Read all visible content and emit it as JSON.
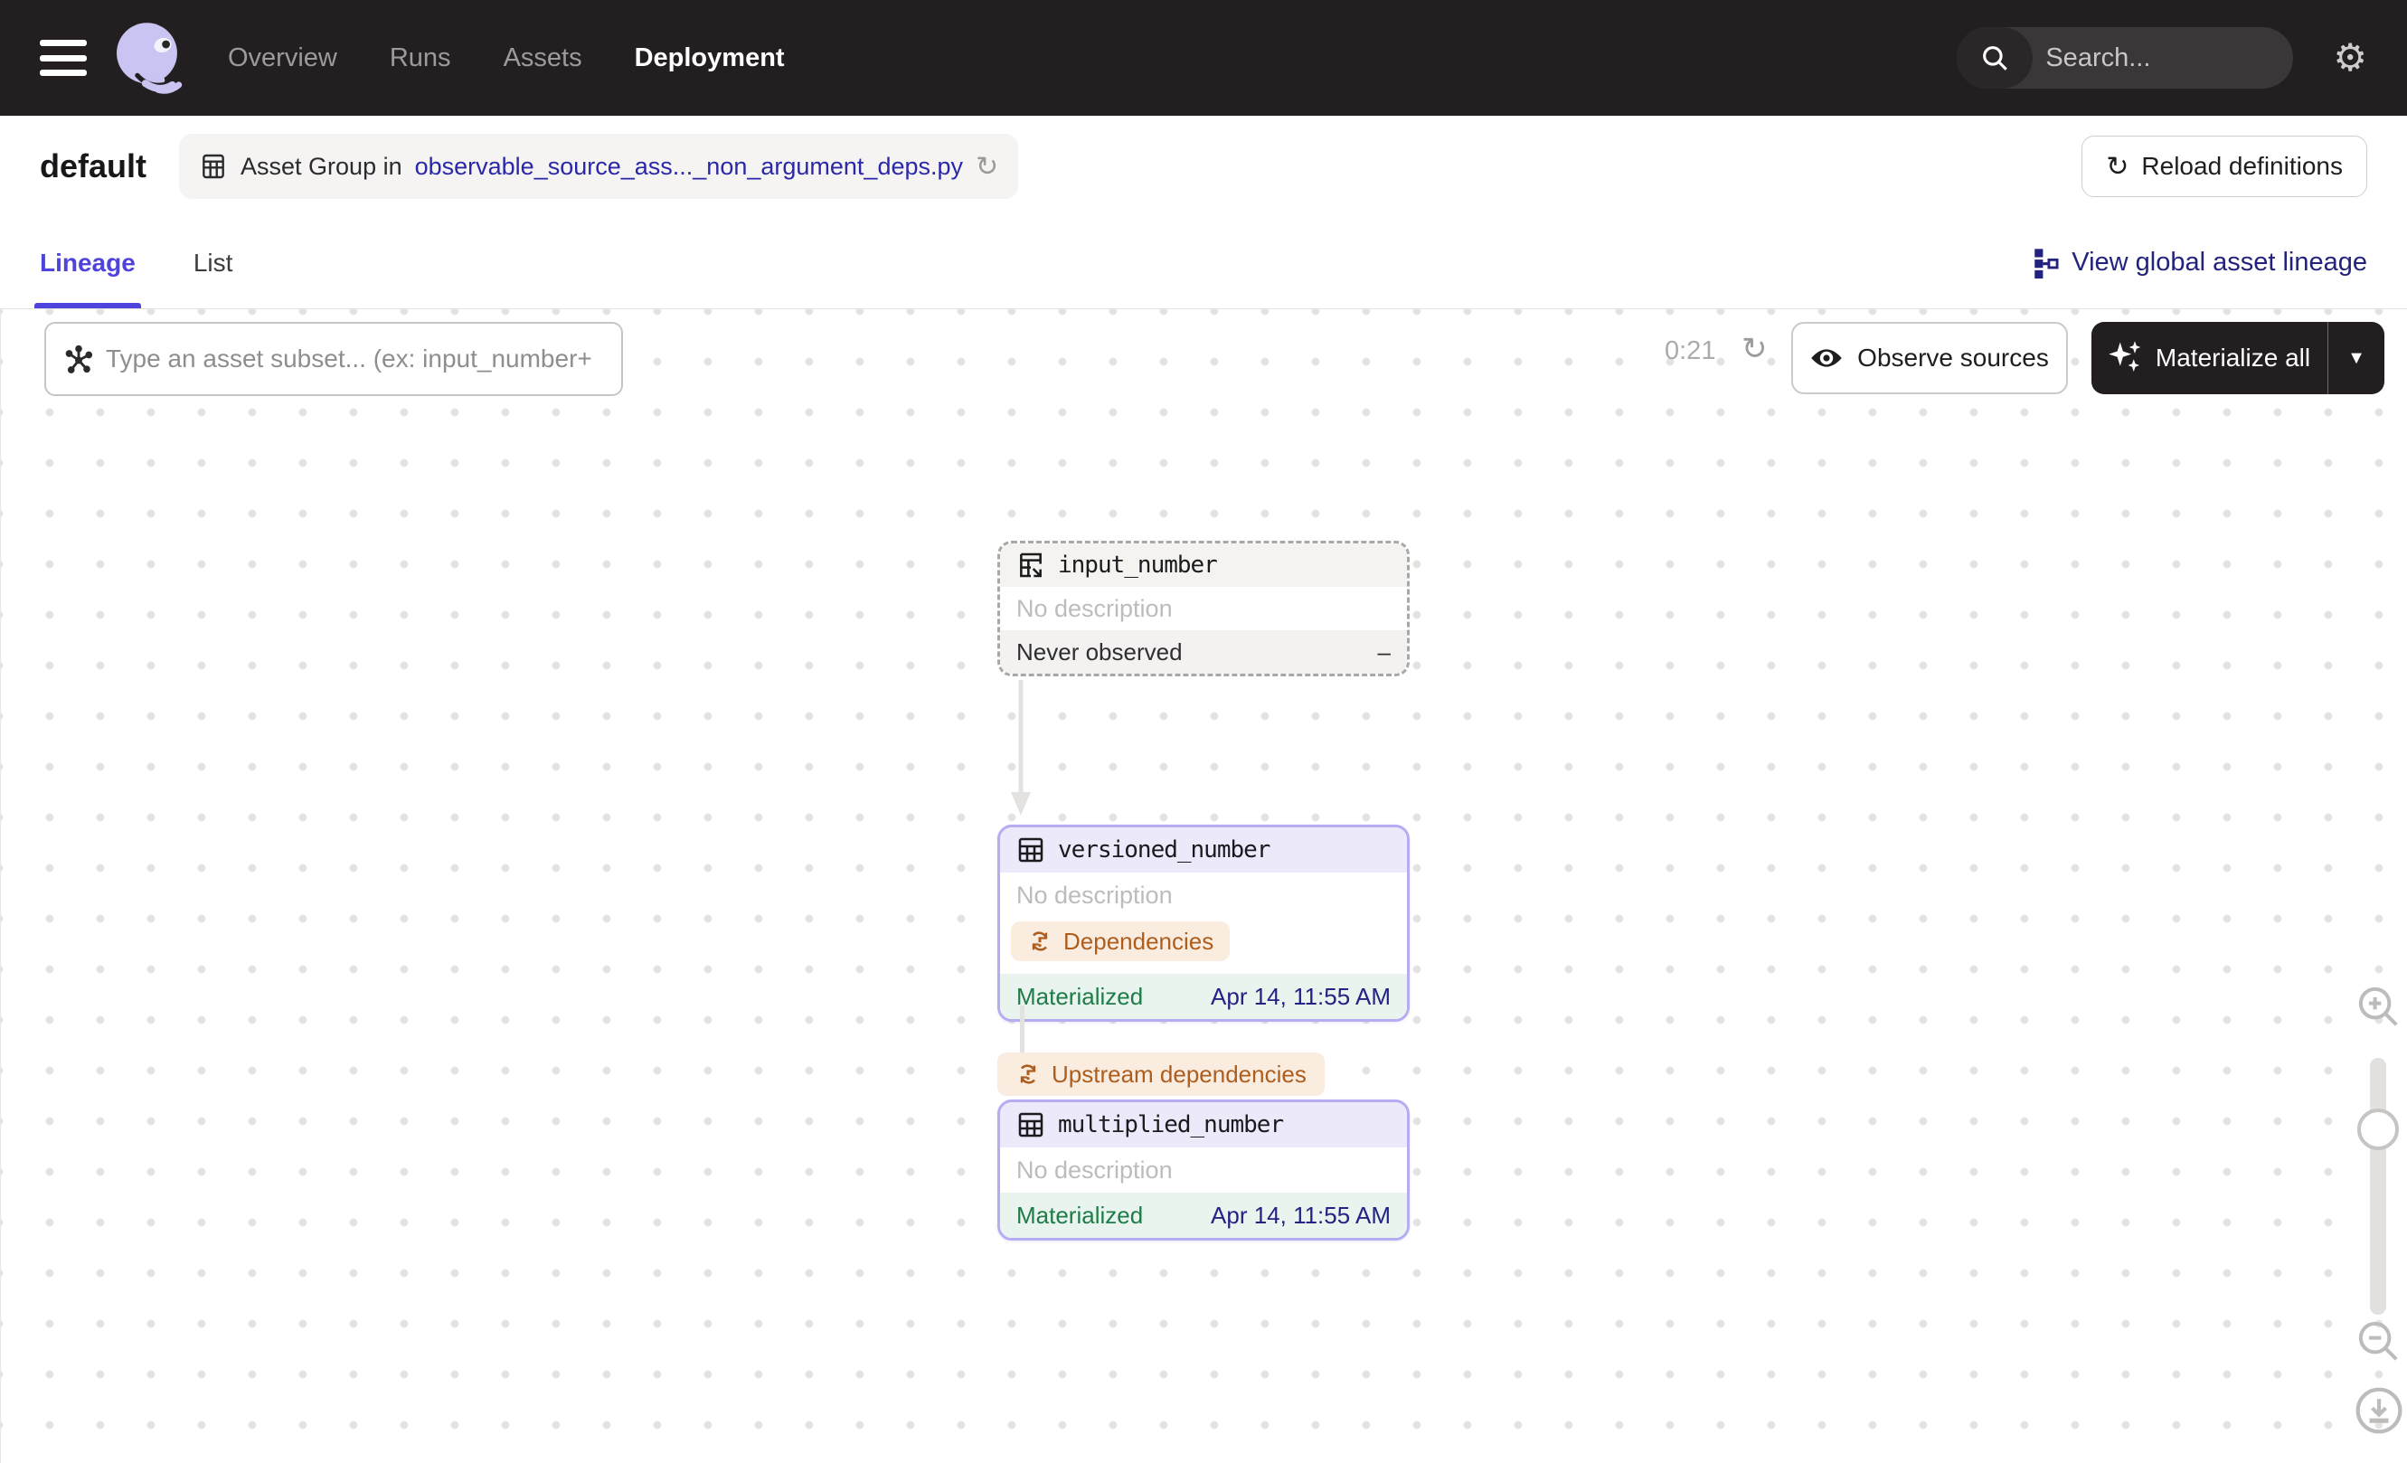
{
  "nav": {
    "links": [
      {
        "label": "Overview"
      },
      {
        "label": "Runs"
      },
      {
        "label": "Assets"
      },
      {
        "label": "Deployment"
      }
    ],
    "search": {
      "placeholder": "Search...",
      "shortcut": "/"
    }
  },
  "header": {
    "title": "default",
    "breadcrumb_prefix": "Asset Group in",
    "breadcrumb_link": "observable_source_ass..._non_argument_deps.py",
    "reload_button": "Reload definitions"
  },
  "tabs": [
    {
      "label": "Lineage",
      "active": true
    },
    {
      "label": "List",
      "active": false
    }
  ],
  "global_lineage_link": "View global asset lineage",
  "toolbar": {
    "filter_placeholder": "Type an asset subset... (ex: input_number+",
    "timer": "0:21",
    "observe_button": "Observe sources",
    "materialize_button": "Materialize all"
  },
  "graph": {
    "edge_label": "Upstream dependencies",
    "nodes": [
      {
        "name": "input_number",
        "description": "No description",
        "status": "Never observed",
        "status_value": "–"
      },
      {
        "name": "versioned_number",
        "description": "No description",
        "tag": "Dependencies",
        "status": "Materialized",
        "status_value": "Apr 14, 11:55 AM"
      },
      {
        "name": "multiplied_number",
        "description": "No description",
        "status": "Materialized",
        "status_value": "Apr 14, 11:55 AM"
      }
    ]
  },
  "colors": {
    "navbar_bg": "#231F20",
    "accent_purple": "#4F43DD",
    "link_navy": "#23237D",
    "node_border_purple": "#B5ACF2",
    "materialized_green": "#1D7C47",
    "date_navy": "#232384",
    "warning_orange": "#AD5E1E",
    "warning_bg": "#FAEDE0"
  }
}
